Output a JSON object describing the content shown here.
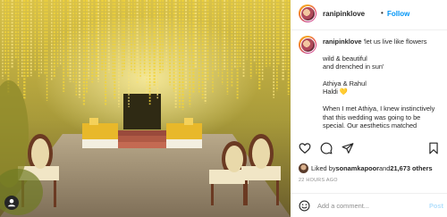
{
  "post": {
    "username": "ranipinklove",
    "follow_label": "Follow",
    "separator": "•",
    "caption": {
      "username": "ranipinklove",
      "line1": " 'let us live like flowers",
      "para2": "wild & beautiful\nand drenched in sun'",
      "para3": "Athiya & Rahul\nHaldi",
      "heart_emoji": "💛",
      "para4": "When I met Athiya, I knew instinctively that this wedding was going to be special. Our aesthetics matched"
    },
    "likes": {
      "prefix": "Liked by ",
      "user": "sonamkapoor",
      "middle": " and ",
      "count": "21,673 others"
    },
    "timestamp": "22 HOURS AGO",
    "comment": {
      "placeholder": "Add a comment...",
      "post_label": "Post"
    }
  },
  "icons": {
    "like": "heart-icon",
    "comment": "comment-icon",
    "share": "share-icon",
    "save": "bookmark-icon",
    "emoji": "emoji-icon",
    "tag": "user-tag-icon"
  },
  "colors": {
    "accent": "#0095f6",
    "post_disabled": "#b2dffc",
    "muted": "#8e8e8e",
    "text": "#262626",
    "flower_yellow": "#f2d43a"
  }
}
